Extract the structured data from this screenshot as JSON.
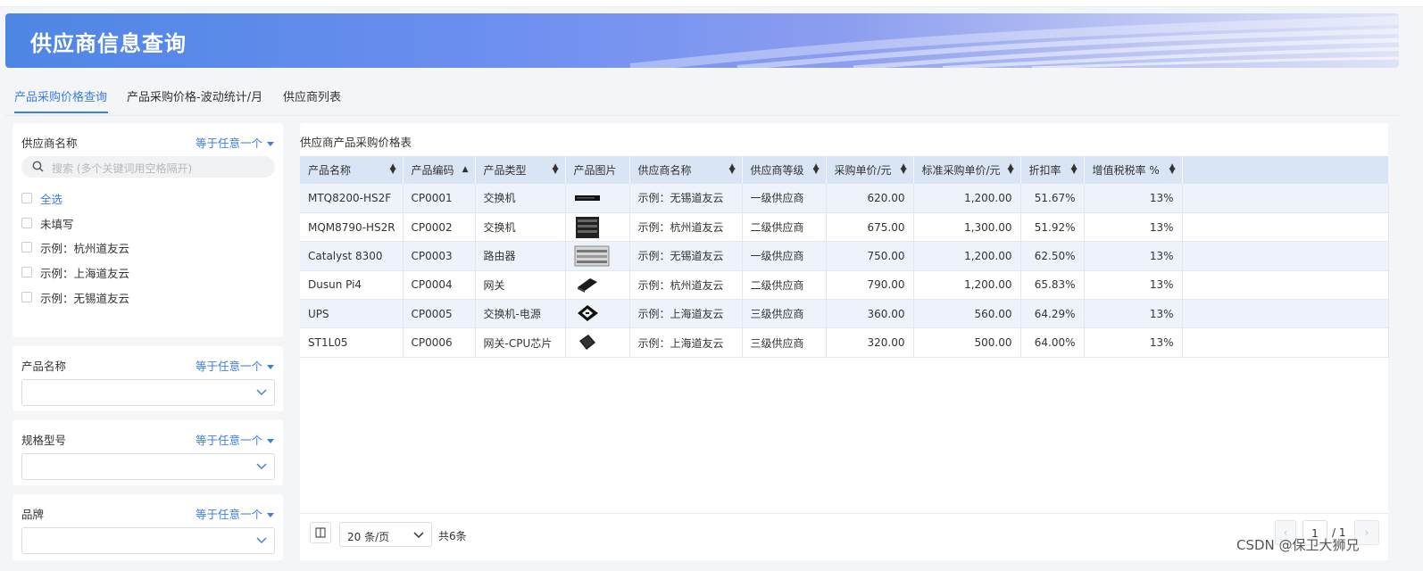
{
  "banner": {
    "title": "供应商信息查询"
  },
  "tabs": [
    {
      "label": "产品采购价格查询",
      "active": true
    },
    {
      "label": "产品采购价格-波动统计/月",
      "active": false
    },
    {
      "label": "供应商列表",
      "active": false
    }
  ],
  "filters": {
    "supplier": {
      "title": "供应商名称",
      "mode": "等于任意一个",
      "search_placeholder": "搜索 (多个关键词用空格隔开)",
      "options": [
        "全选",
        "未填写",
        "示例：杭州道友云",
        "示例：上海道友云",
        "示例：无锡道友云"
      ]
    },
    "product": {
      "title": "产品名称",
      "mode": "等于任意一个"
    },
    "spec": {
      "title": "规格型号",
      "mode": "等于任意一个"
    },
    "brand": {
      "title": "品牌",
      "mode": "等于任意一个"
    }
  },
  "table": {
    "title": "供应商产品采购价格表",
    "columns": [
      "产品名称",
      "产品编码",
      "产品类型",
      "产品图片",
      "供应商名称",
      "供应商等级",
      "采购单价/元",
      "标准采购单价/元",
      "折扣率",
      "增值税税率 %"
    ],
    "sort_state": [
      "both",
      "asc",
      "both",
      "none",
      "both",
      "both",
      "both",
      "both",
      "both",
      "both"
    ],
    "rows": [
      {
        "name": "MTQ8200-HS2F",
        "code": "CP0001",
        "type": "交换机",
        "image": "switch-1u",
        "supplier": "示例：无锡道友云",
        "level": "一级供应商",
        "price": "620.00",
        "std_price": "1,200.00",
        "discount": "51.67%",
        "tax": "13%"
      },
      {
        "name": "MQM8790-HS2R",
        "code": "CP0002",
        "type": "交换机",
        "image": "switch-panel",
        "supplier": "示例：杭州道友云",
        "level": "二级供应商",
        "price": "675.00",
        "std_price": "1,300.00",
        "discount": "51.92%",
        "tax": "13%"
      },
      {
        "name": "Catalyst 8300",
        "code": "CP0003",
        "type": "路由器",
        "image": "router-rack",
        "supplier": "示例：无锡道友云",
        "level": "一级供应商",
        "price": "750.00",
        "std_price": "1,200.00",
        "discount": "62.50%",
        "tax": "13%"
      },
      {
        "name": "Dusun Pi4",
        "code": "CP0004",
        "type": "网关",
        "image": "gateway-box",
        "supplier": "示例：杭州道友云",
        "level": "二级供应商",
        "price": "790.00",
        "std_price": "1,200.00",
        "discount": "65.83%",
        "tax": "13%"
      },
      {
        "name": "UPS",
        "code": "CP0005",
        "type": "交换机-电源",
        "image": "ups-module",
        "supplier": "示例：上海道友云",
        "level": "三级供应商",
        "price": "360.00",
        "std_price": "560.00",
        "discount": "64.29%",
        "tax": "13%"
      },
      {
        "name": "ST1L05",
        "code": "CP0006",
        "type": "网关-CPU芯片",
        "image": "cpu-chip",
        "supplier": "示例：上海道友云",
        "level": "三级供应商",
        "price": "320.00",
        "std_price": "500.00",
        "discount": "64.00%",
        "tax": "13%"
      }
    ]
  },
  "pagination": {
    "page_size": "20 条/页",
    "total": "共6条",
    "current": "1",
    "total_pages": "/ 1"
  },
  "watermark": "CSDN @保卫大狮兄",
  "colors": {
    "accent": "#3b7ee0",
    "header_bg": "#d9e5f4",
    "row_alt": "#eef3fb"
  }
}
